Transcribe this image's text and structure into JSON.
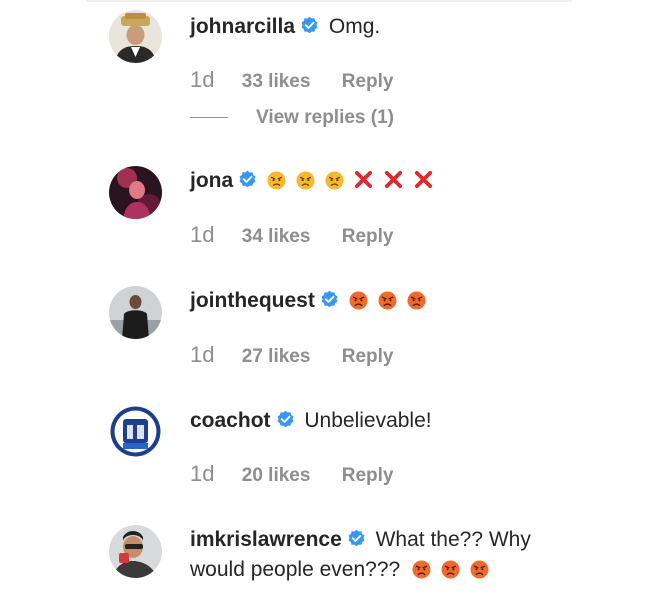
{
  "comments": [
    {
      "username": "johnarcilla",
      "verified": true,
      "text": "Omg.",
      "time": "1d",
      "likes": "33 likes",
      "reply": "Reply",
      "view_replies": "View replies (1)"
    },
    {
      "username": "jona",
      "verified": true,
      "text": "",
      "reactions": [
        "angry-face-icon",
        "angry-face-icon",
        "angry-face-icon",
        "cross-mark-icon",
        "cross-mark-icon",
        "cross-mark-icon"
      ],
      "time": "1d",
      "likes": "34 likes",
      "reply": "Reply"
    },
    {
      "username": "jointhequest",
      "verified": true,
      "text": "",
      "reactions": [
        "pouting-face-icon",
        "pouting-face-icon",
        "pouting-face-icon"
      ],
      "time": "1d",
      "likes": "27 likes",
      "reply": "Reply"
    },
    {
      "username": "coachot",
      "verified": true,
      "text": "Unbelievable!",
      "time": "1d",
      "likes": "20 likes",
      "reply": "Reply"
    },
    {
      "username": "imkrislawrence",
      "verified": true,
      "text_line1": "What the?? Why",
      "text_line2": "would people even???",
      "reactions": [
        "pouting-face-icon",
        "pouting-face-icon",
        "pouting-face-icon"
      ]
    }
  ],
  "colors": {
    "verified_blue": "#3897f0",
    "meta_gray": "#8e8e8e",
    "text": "#262626",
    "angry_yellow": "#f7b82c",
    "pouting_red": "#f06a2c",
    "cross_red": "#dd2a2a"
  }
}
